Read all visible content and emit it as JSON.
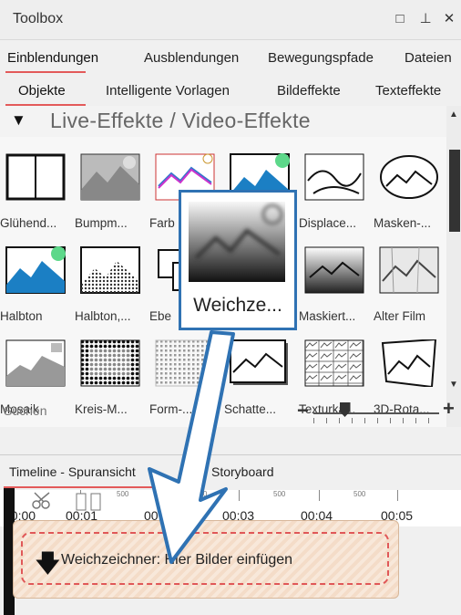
{
  "window": {
    "title": "Toolbox",
    "buttons": [
      "□",
      "⊥",
      "✕"
    ]
  },
  "tabs_row1": [
    {
      "label": "Einblendungen",
      "active": true
    },
    {
      "label": "Ausblendungen"
    },
    {
      "label": "Bewegungspfade"
    },
    {
      "label": "Dateien"
    }
  ],
  "tabs_row2": [
    {
      "label": "Objekte",
      "active": true
    },
    {
      "label": "Intelligente Vorlagen"
    },
    {
      "label": "Bildeffekte"
    },
    {
      "label": "Texteffekte"
    }
  ],
  "section": {
    "label": "Live-Effekte / Video-Effekte",
    "toggle": "▼"
  },
  "effects": [
    {
      "label": "Glühend...",
      "icon": "glow-effect-icon"
    },
    {
      "label": "Bumpm...",
      "icon": "bumpmap-effect-icon"
    },
    {
      "label": "Farb",
      "icon": "color-effect-icon"
    },
    {
      "label": "",
      "icon": "mountain-effect-icon"
    },
    {
      "label": "Displace...",
      "icon": "displace-effect-icon"
    },
    {
      "label": "Masken-...",
      "icon": "mask-effect-icon"
    },
    {
      "label": "Halbton",
      "icon": "halftone-effect-icon"
    },
    {
      "label": "Halbton,...",
      "icon": "halftone-bw-effect-icon"
    },
    {
      "label": "Ebe",
      "icon": "layer-effect-icon"
    },
    {
      "label": "",
      "icon": "hidden-effect-icon"
    },
    {
      "label": "Maskiert...",
      "icon": "masked-effect-icon"
    },
    {
      "label": "Alter Film",
      "icon": "old-film-effect-icon"
    },
    {
      "label": "Mosaik",
      "icon": "mosaic-effect-icon"
    },
    {
      "label": "Kreis-M...",
      "icon": "circle-mosaic-effect-icon"
    },
    {
      "label": "Form-...",
      "icon": "shape-mosaic-effect-icon"
    },
    {
      "label": "Schatte...",
      "icon": "shadow-effect-icon"
    },
    {
      "label": "Texturka...",
      "icon": "texture-effect-icon"
    },
    {
      "label": "3D-Rota...",
      "icon": "3d-rotation-effect-icon"
    }
  ],
  "search": {
    "placeholder": "Suchen"
  },
  "zoom": {
    "minus": "−",
    "plus": "+",
    "level": 0.25
  },
  "timeline": {
    "tab_label": "Timeline - Spuransicht",
    "tab2_label": "Storyboard",
    "time_marks": [
      "00:00",
      "00:01",
      "00:02",
      "00:03",
      "00:04",
      "00:05"
    ],
    "sub_marks": [
      "500",
      "500",
      "500",
      "500"
    ]
  },
  "drop_zone": {
    "text": "Weichzeichner: Hier Bilder einfügen"
  },
  "drag_popup": {
    "label": "Weichze..."
  },
  "colors": {
    "accent_blue": "#2f72b3",
    "tab_underline": "#e35a5a",
    "drop_border": "#e05858"
  }
}
